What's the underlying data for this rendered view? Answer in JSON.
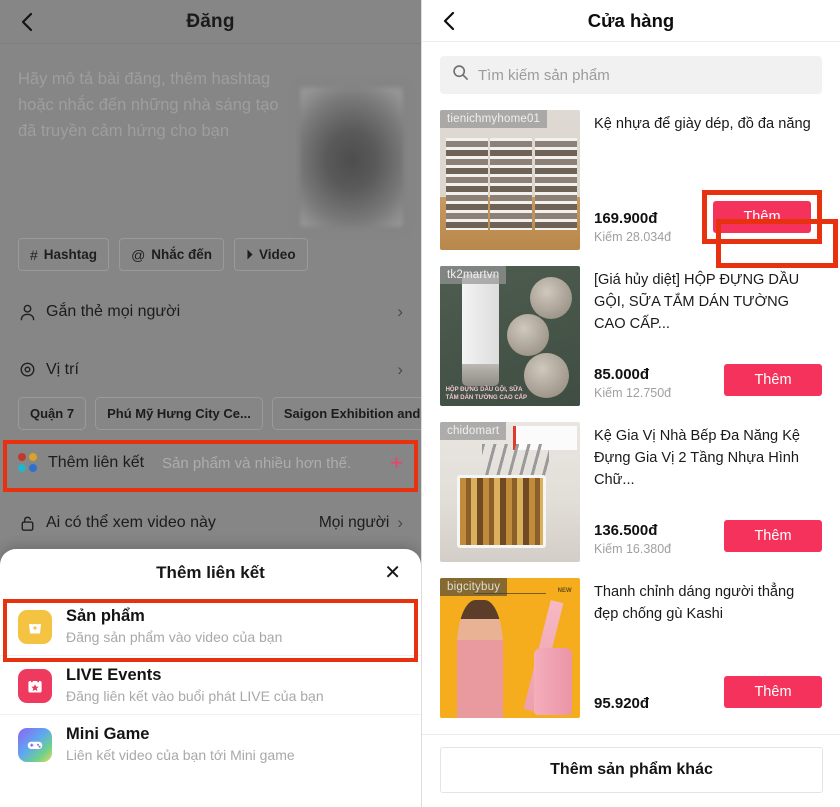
{
  "left": {
    "header": {
      "title": "Đăng",
      "back_icon": "back-chevron-icon"
    },
    "compose": {
      "placeholder": "Hãy mô tả bài đăng, thêm hashtag\nhoặc nhắc đến những nhà sáng tạo\nđã truyền cảm hứng cho bạn"
    },
    "chips": [
      {
        "glyph": "#",
        "label": "Hashtag"
      },
      {
        "glyph": "@",
        "label": "Nhắc đến"
      },
      {
        "glyph": "⏵",
        "label": "Video"
      }
    ],
    "rows": [
      {
        "label": "Gắn thẻ mọi người",
        "icon": "person-icon",
        "value": "",
        "chevron": "›"
      },
      {
        "label": "Vị trí",
        "icon": "location-pin-icon",
        "value": "",
        "chevron": "›"
      }
    ],
    "location_chips": [
      "Quận 7",
      "Phú Mỹ Hưng City Ce...",
      "Saigon Exhibition and..."
    ],
    "link_row": {
      "title": "Thêm liên kết",
      "subtitle": "Sản phẩm và nhiều hơn thế.",
      "plus": "+",
      "icon": "four-dots-icon",
      "dot_colors": [
        "#c0392b",
        "#d9a32b",
        "#25b5c9",
        "#2f6fd0"
      ]
    },
    "privacy_row": {
      "label": "Ai có thể xem video này",
      "value": "Mọi người",
      "chevron": "›",
      "icon": "unlock-icon"
    },
    "sheet": {
      "title": "Thêm liên kết",
      "close": "✕",
      "items": [
        {
          "title": "Sản phẩm",
          "subtitle": "Đăng sản phẩm vào video của bạn",
          "icon": "shopping-bag-icon",
          "icon_bg": "#f5c342",
          "highlighted": true
        },
        {
          "title": "LIVE Events",
          "subtitle": "Đăng liên kết vào buổi phát LIVE của bạn",
          "icon": "calendar-star-icon",
          "icon_bg": "#ee3a5f",
          "highlighted": false
        },
        {
          "title": "Mini Game",
          "subtitle": "Liên kết video của bạn tới Mini game",
          "icon": "gamepad-icon",
          "icon_bg": "#9b6bf0",
          "highlighted": false
        }
      ]
    }
  },
  "right": {
    "header": {
      "title": "Cửa hàng",
      "back_icon": "back-chevron-icon"
    },
    "search": {
      "placeholder": "Tìm kiếm sản phẩm",
      "value": "",
      "icon": "search-icon"
    },
    "products": [
      {
        "shop": "tienichmyhome01",
        "name": "Kệ nhựa để giày dép, đồ đa năng",
        "price": "169.900đ",
        "commission": "Kiếm 28.034đ",
        "add_label": "Thêm",
        "highlighted": true
      },
      {
        "shop": "tk2martvn",
        "name": "[Giá hủy diệt] HỘP ĐỰNG DẦU GỘI, SỮA TẮM DÁN TƯỜNG CAO CẤP...",
        "price": "85.000đ",
        "commission": "Kiếm 12.750đ",
        "add_label": "Thêm",
        "highlighted": false
      },
      {
        "shop": "chidomart",
        "name": "Kệ Gia Vị Nhà Bếp Đa Năng Kệ Đựng Gia Vị 2 Tầng Nhựa Hình Chữ...",
        "price": "136.500đ",
        "commission": "Kiếm 16.380đ",
        "add_label": "Thêm",
        "highlighted": false
      },
      {
        "shop": "bigcitybuy",
        "name": "Thanh chỉnh dáng người thẳng đẹp chống gù Kashi",
        "price": "95.920đ",
        "commission": "",
        "add_label": "Thêm",
        "highlighted": false
      }
    ],
    "footer": {
      "more_label": "Thêm sản phẩm khác"
    }
  },
  "colors": {
    "accent_pink": "#f4325b",
    "highlight_red": "#e8310e",
    "toggle_green": "#20bf6b",
    "dim_overlay": "#868686"
  }
}
